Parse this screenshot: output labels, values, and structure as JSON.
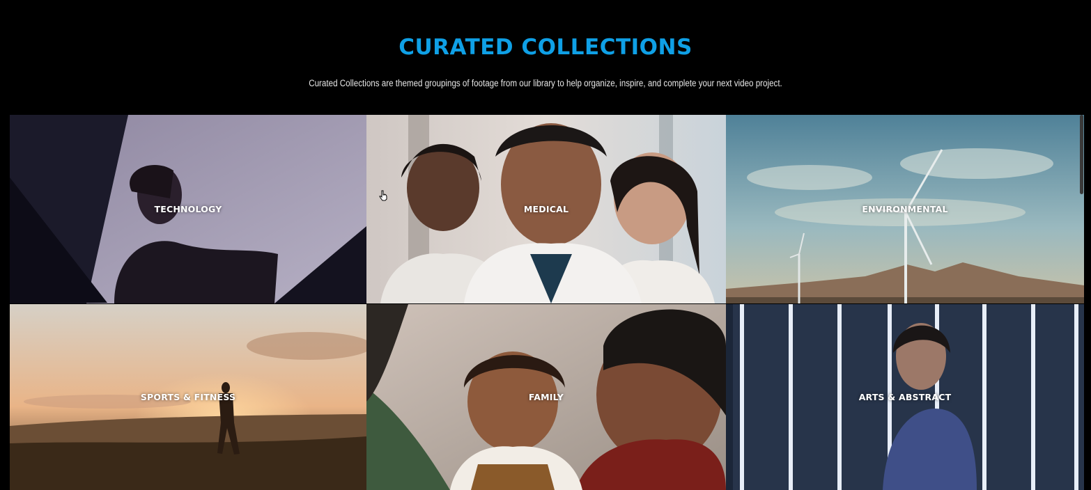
{
  "header": {
    "title": "CURATED COLLECTIONS",
    "subtitle": "Curated Collections are themed groupings of footage from our library to help organize, inspire, and complete your next video project."
  },
  "collections": [
    {
      "label": "TECHNOLOGY"
    },
    {
      "label": "MEDICAL"
    },
    {
      "label": "ENVIRONMENTAL"
    },
    {
      "label": "SPORTS & FITNESS"
    },
    {
      "label": "FAMILY"
    },
    {
      "label": "ARTS & ABSTRACT"
    }
  ],
  "colors": {
    "background": "#000000",
    "title_accent": "#0fa0e6",
    "label_text": "#ffffff"
  }
}
